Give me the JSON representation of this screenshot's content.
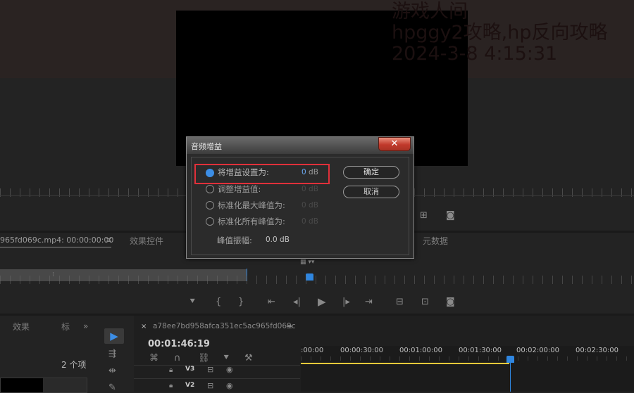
{
  "watermark": {
    "line1": "游戏人间",
    "line2": "hpggy2攻略,hp反向攻略",
    "line3": "2024-3-8 4:15:31"
  },
  "source_panel": {
    "clip_tab": "965fd069c.mp4: 00:00:00:00",
    "effects_tab": "效果控件",
    "metadata_tab": "元数据"
  },
  "dialog": {
    "title": "音频增益",
    "close_glyph": "✕",
    "options": [
      {
        "label": "将增益设置为:",
        "value": "0",
        "unit": "dB",
        "selected": true
      },
      {
        "label": "调整增益值:",
        "value": "0",
        "unit": "dB",
        "selected": false
      },
      {
        "label": "标准化最大峰值为:",
        "value": "0",
        "unit": "dB",
        "selected": false
      },
      {
        "label": "标准化所有峰值为:",
        "value": "0",
        "unit": "dB",
        "selected": false
      }
    ],
    "peak_label": "峰值振幅:",
    "peak_value": "0.0 dB",
    "ok_label": "确定",
    "cancel_label": "取消"
  },
  "project_panel": {
    "effects_tab": "效果",
    "partial_tab": "标",
    "item_count": "2 个项"
  },
  "timeline": {
    "close_glyph": "×",
    "sequence_name": "a78ee7bd958afca351ec5ac965fd069c",
    "timecode": "00:01:46:19",
    "ruler_labels": [
      ":00:00",
      "00:00:30:00",
      "00:01:00:00",
      "00:01:30:00",
      "00:02:00:00",
      "00:02:30:00"
    ],
    "tracks": [
      {
        "name": "V3"
      },
      {
        "name": "V2"
      }
    ]
  },
  "colors": {
    "accent": "#3c8ee6",
    "highlight_box": "#e0303a",
    "work_area": "#e8c93a",
    "playhead": "#2f86e0"
  }
}
